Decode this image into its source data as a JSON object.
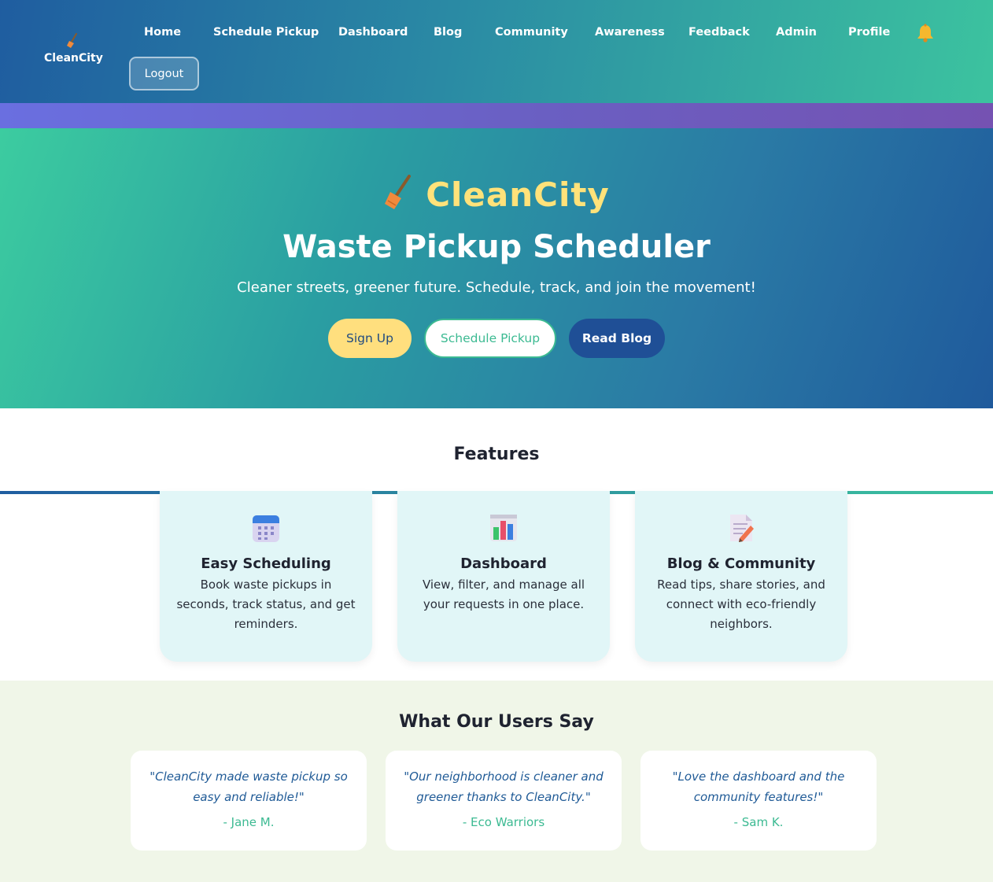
{
  "nav": {
    "brand": "CleanCity",
    "links": [
      {
        "label": "Home"
      },
      {
        "label": "Schedule Pickup"
      },
      {
        "label": "Dashboard"
      },
      {
        "label": "Blog"
      },
      {
        "label": "Community"
      },
      {
        "label": "Awareness"
      },
      {
        "label": "Feedback"
      },
      {
        "label": "Admin"
      },
      {
        "label": "Profile"
      }
    ],
    "bell_icon": "bell-icon",
    "logout_label": "Logout"
  },
  "hero": {
    "brand": "CleanCity",
    "brand_icon": "broom-icon",
    "title": "Waste Pickup Scheduler",
    "subtitle": "Cleaner streets, greener future. Schedule, track, and join the movement!",
    "buttons": {
      "signup": "Sign Up",
      "schedule": "Schedule Pickup",
      "blog": "Read Blog"
    }
  },
  "features": {
    "title": "Features",
    "cards": [
      {
        "icon": "calendar-icon",
        "title": "Easy Scheduling",
        "desc": "Book waste pickups in seconds, track status, and get reminders."
      },
      {
        "icon": "bar-chart-icon",
        "title": "Dashboard",
        "desc": "View, filter, and manage all your requests in one place."
      },
      {
        "icon": "memo-icon",
        "title": "Blog & Community",
        "desc": "Read tips, share stories, and connect with eco-friendly neighbors."
      }
    ]
  },
  "testimonials": {
    "title": "What Our Users Say",
    "items": [
      {
        "quote": "\"CleanCity made waste pickup so easy and reliable!\"",
        "author": "- Jane M."
      },
      {
        "quote": "\"Our neighborhood is cleaner and greener thanks to CleanCity.\"",
        "author": "- Eco Warriors"
      },
      {
        "quote": "\"Love the dashboard and the community features!\"",
        "author": "- Sam K."
      }
    ]
  },
  "colors": {
    "accent_yellow": "#ffdf7e",
    "accent_green": "#3cba92",
    "accent_blue": "#1f4f96"
  }
}
